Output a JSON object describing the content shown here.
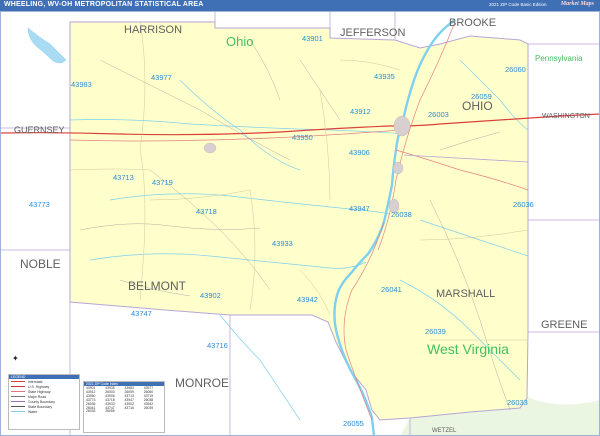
{
  "header": {
    "title": "WHEELING, WV-OH METROPOLITAN STATISTICAL AREA",
    "edition": "2021 ZIP Code Basic Edition",
    "logo": "Market Maps"
  },
  "counties": [
    "HARRISON",
    "JEFFERSON",
    "BROOKE",
    "GUERNSEY",
    "WASHINGTON",
    "NOBLE",
    "BELMONT",
    "MARSHALL",
    "GREENE",
    "MONROE",
    "WETZEL"
  ],
  "states": [
    "Ohio",
    "OHIO",
    "Pennsylvania",
    "West Virginia"
  ],
  "zip_codes": [
    "43901",
    "43935",
    "43983",
    "43977",
    "43912",
    "26003",
    "26059",
    "26060",
    "43950",
    "43906",
    "43713",
    "43719",
    "43773",
    "43718",
    "43947",
    "26038",
    "26036",
    "43933",
    "43902",
    "43942",
    "26041",
    "43747",
    "43716",
    "26039",
    "26033",
    "26055"
  ],
  "legend": {
    "title": "LEGEND",
    "items": [
      "Interstate",
      "U.S. Highway",
      "State Highway",
      "Major Road",
      "County Boundary",
      "State Boundary",
      "Water"
    ],
    "colors": [
      "#d9413a",
      "#cc3333",
      "#e07a7a",
      "#777777",
      "#9a6cc0",
      "#555555",
      "#7ccdf0"
    ]
  },
  "index_panel": {
    "title": "2021 ZIP Code Index"
  },
  "colors": {
    "msa_fill": "#ffffcc",
    "outside_fill": "#ffffff",
    "zip_label": "#2a8fd8",
    "county_label": "#606060",
    "state_label": "#40c060",
    "river": "#7fd0ee",
    "header_bg": "#3f6fb5"
  }
}
